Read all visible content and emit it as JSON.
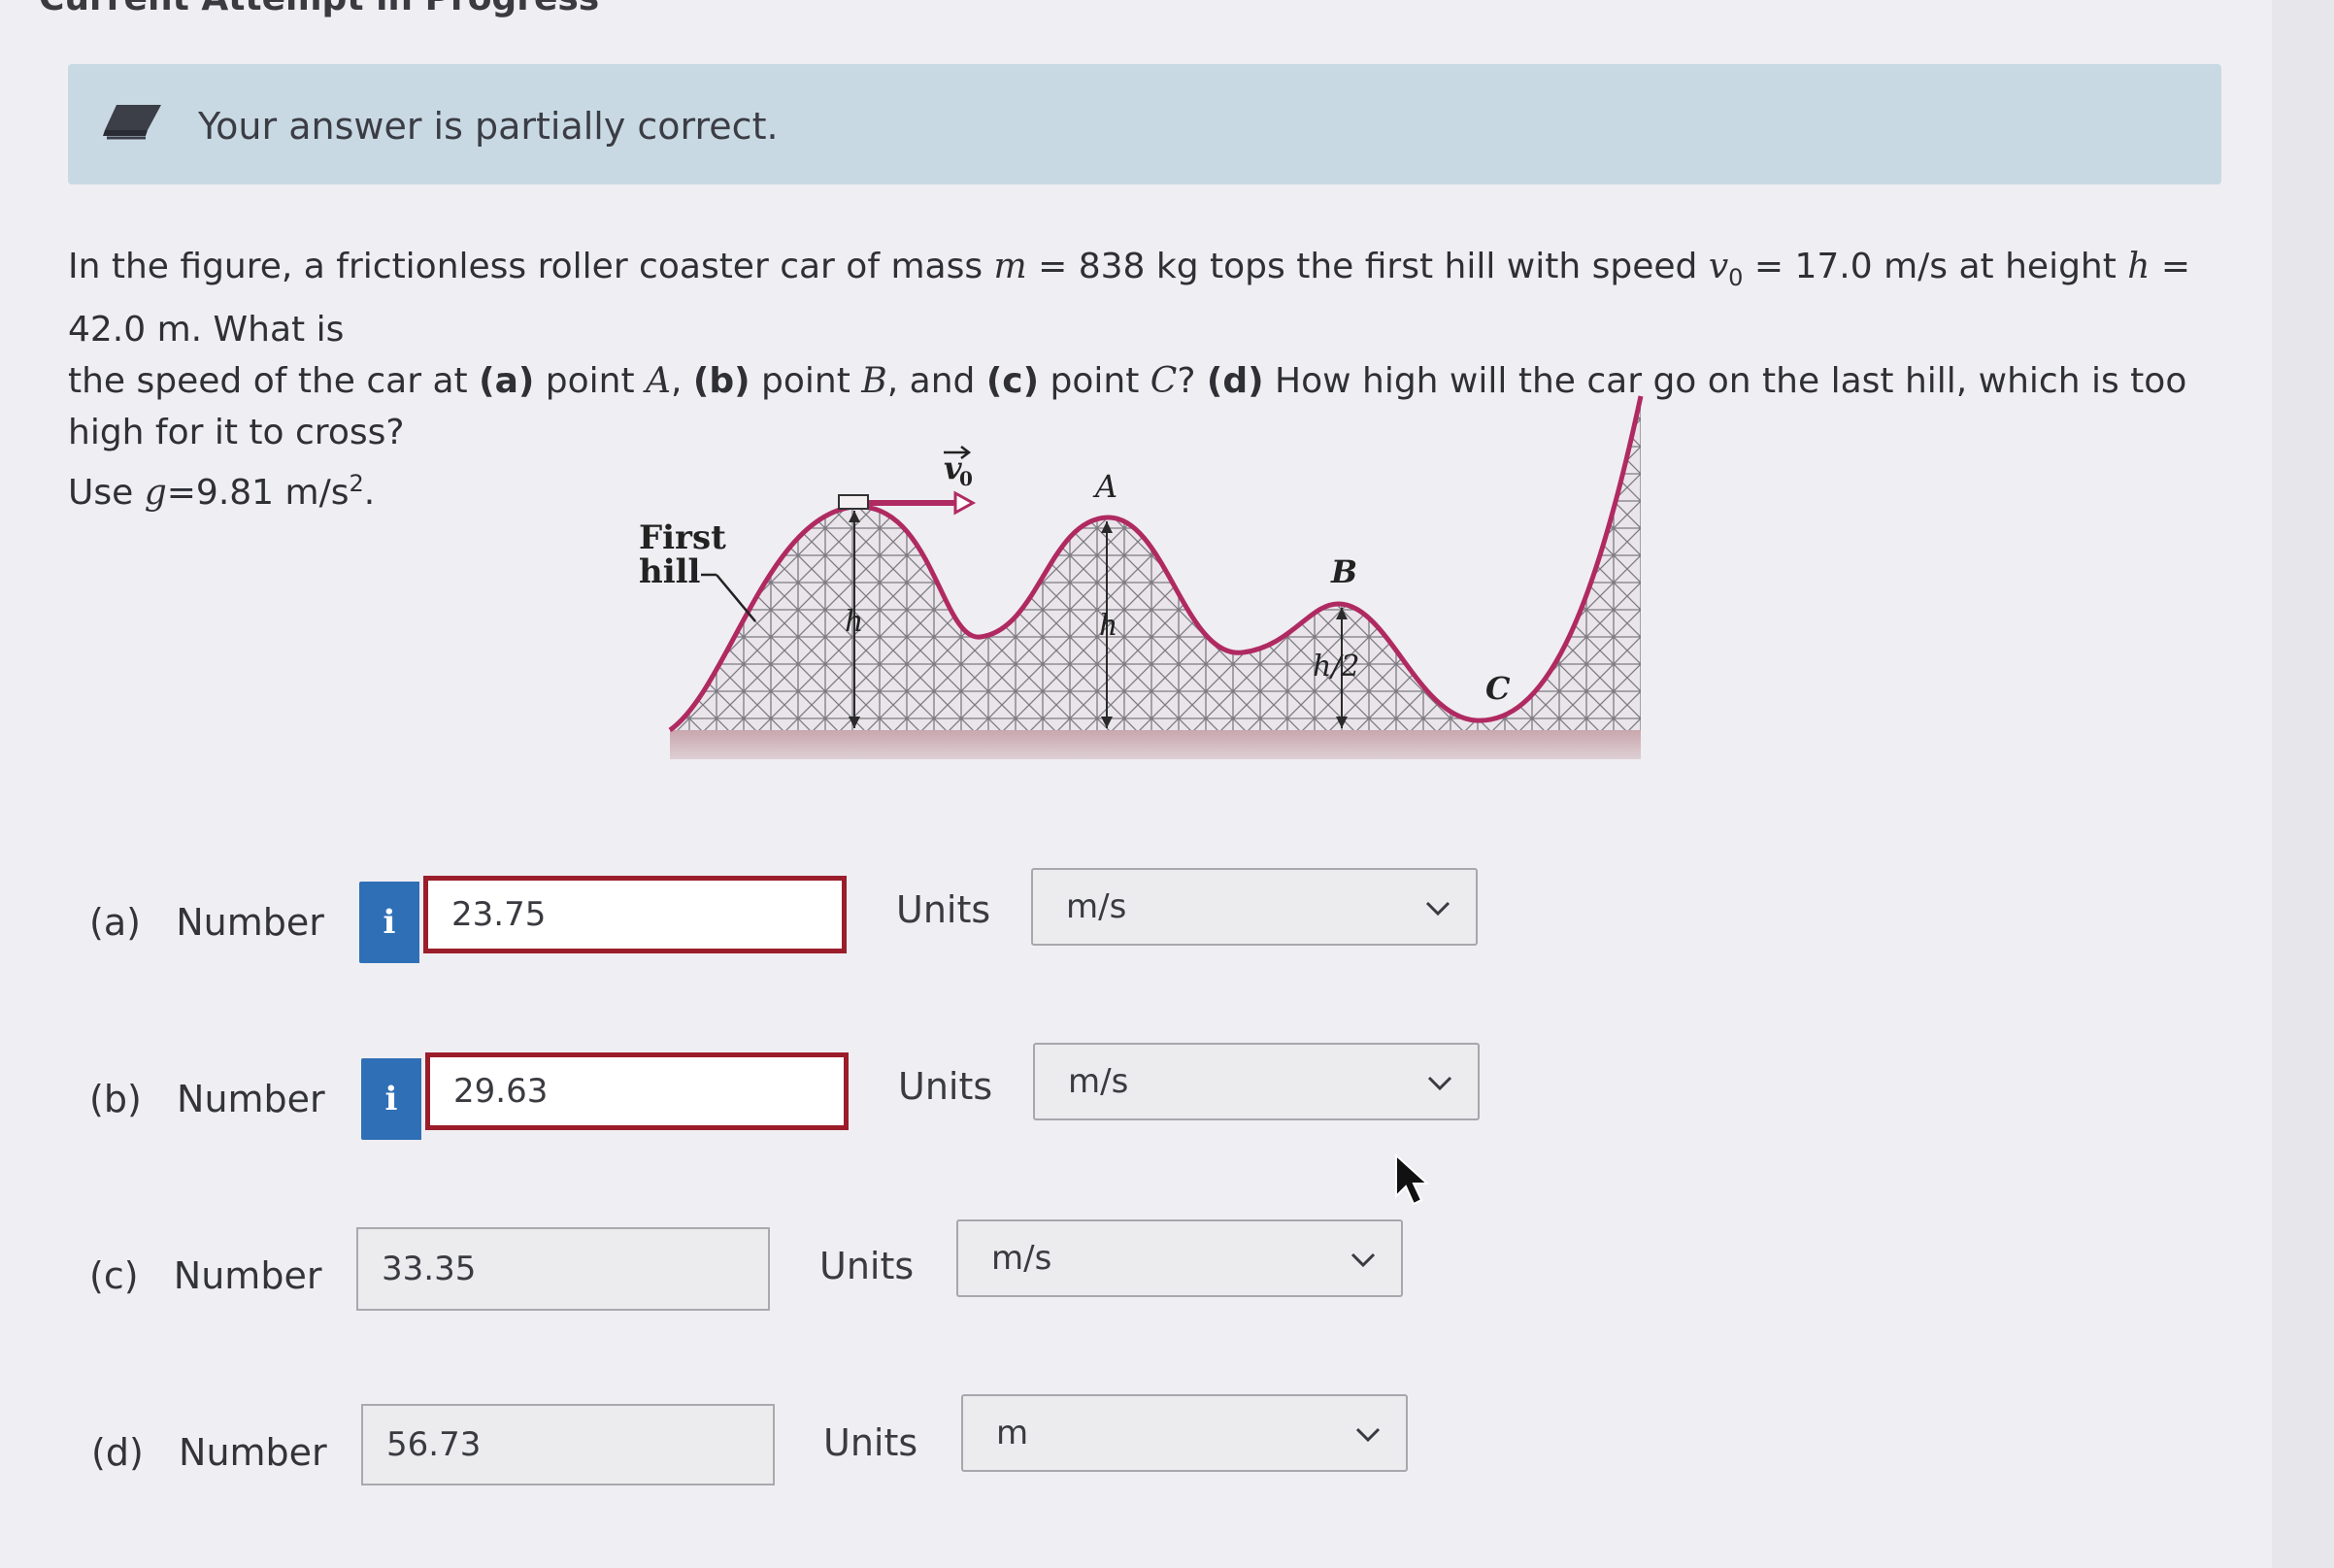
{
  "header": {
    "cut_title": "Current Attempt in Progress"
  },
  "banner": {
    "message": "Your answer is partially correct.",
    "icon": "pencil-icon",
    "color": "#c9d9e4"
  },
  "question": {
    "line1_a": "In the figure, a frictionless roller coaster car of mass ",
    "m_var": "m",
    "line1_b": " = 838 kg tops the first hill with speed ",
    "v_var": "v",
    "v_sub": "0",
    "line1_c": " = 17.0 m/s at height ",
    "h_var": "h",
    "line1_d": " = 42.0 m. What is",
    "line2_a": "the speed of the car at ",
    "pa": "(a)",
    "line2_b": " point ",
    "A": "A",
    "line2_c": ", ",
    "pb": "(b)",
    "line2_d": " point ",
    "B": "B",
    "line2_e": ", and ",
    "pc": "(c)",
    "line2_f": " point ",
    "C": "C",
    "line2_g": "? ",
    "pd": "(d)",
    "line2_h": " How high will the car go on the last hill, which is too high for it to cross?",
    "line3_a": "Use ",
    "g_var": "g",
    "line3_b": "=9.81 m/s",
    "line3_sup": "2",
    "line3_c": "."
  },
  "figure": {
    "first": "First",
    "hill": "hill",
    "v0_label": "v",
    "v0_sub": "0",
    "label_A": "A",
    "label_B": "B",
    "label_C": "C",
    "label_h1": "h",
    "label_h2": "h",
    "label_h_half": "h/2"
  },
  "answers": [
    {
      "part": "(a)",
      "label": "Number",
      "value": "23.75",
      "units_label": "Units",
      "units": "m/s",
      "status": "incorrect"
    },
    {
      "part": "(b)",
      "label": "Number",
      "value": "29.63",
      "units_label": "Units",
      "units": "m/s",
      "status": "incorrect"
    },
    {
      "part": "(c)",
      "label": "Number",
      "value": "33.35",
      "units_label": "Units",
      "units": "m/s",
      "status": "correct"
    },
    {
      "part": "(d)",
      "label": "Number",
      "value": "56.73",
      "units_label": "Units",
      "units": "m",
      "status": "correct"
    }
  ],
  "info_button": {
    "glyph": "i",
    "color": "#2f6fb6"
  },
  "colors": {
    "incorrect_border": "#9b1d2a",
    "track": "#b02a62"
  }
}
